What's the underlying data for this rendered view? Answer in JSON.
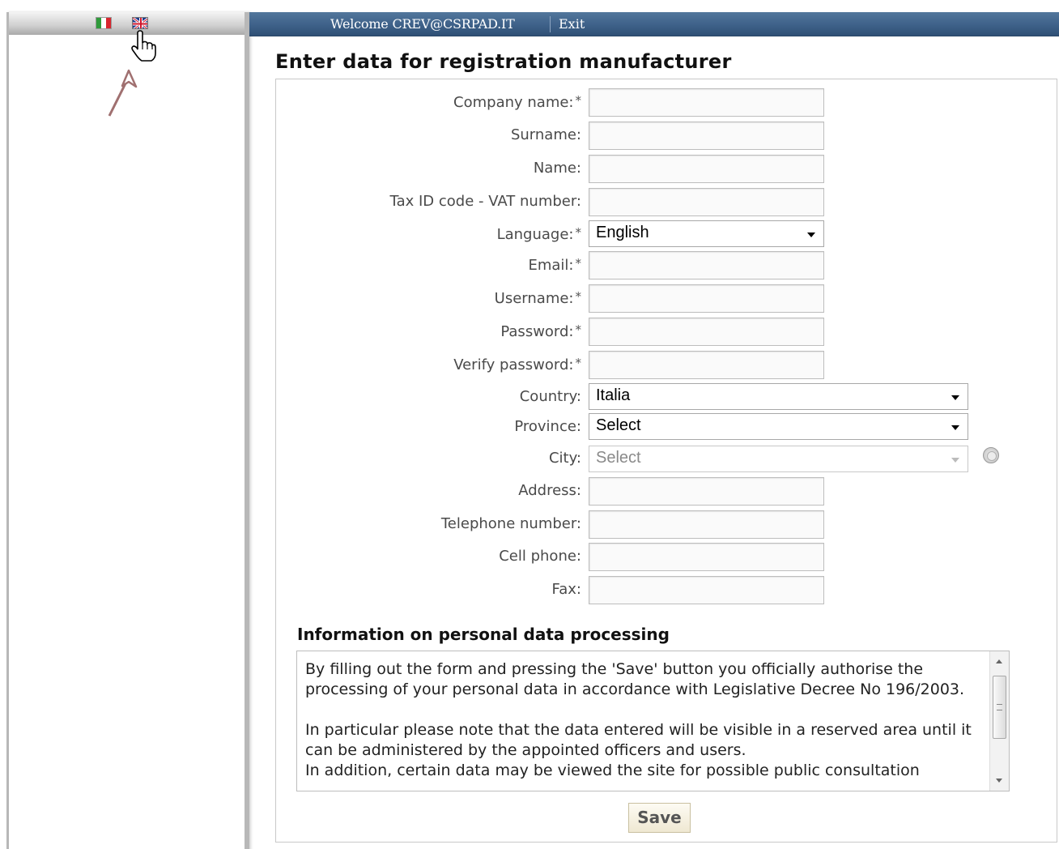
{
  "header": {
    "welcome_text": "Welcome CREV@CSRPAD.IT",
    "exit_label": "Exit"
  },
  "languages": [
    {
      "name": "Italian",
      "icon": "italian-flag-icon",
      "colors": [
        "#2f9a3a",
        "#ffffff",
        "#d7262e"
      ]
    },
    {
      "name": "English",
      "icon": "uk-flag-icon",
      "colors": [
        "#1d3a8c",
        "#ffffff",
        "#cf142b"
      ]
    }
  ],
  "page_title": "Enter data for registration manufacturer",
  "form": {
    "required_mark": "*",
    "company_name_label": "Company name:",
    "surname_label": "Surname:",
    "name_label": "Name:",
    "tax_id_label": "Tax ID code - VAT number:",
    "language_label": "Language:",
    "language_value": "English",
    "email_label": "Email:",
    "username_label": "Username:",
    "password_label": "Password:",
    "verify_password_label": "Verify password:",
    "country_label": "Country:",
    "country_value": "Italia",
    "province_label": "Province:",
    "province_value": "Select",
    "city_label": "City:",
    "city_value": "Select",
    "address_label": "Address:",
    "telephone_label": "Telephone number:",
    "cell_phone_label": "Cell phone:",
    "fax_label": "Fax:"
  },
  "privacy": {
    "title": "Information on personal data processing",
    "paragraph_1": "By filling out the form and pressing the 'Save' button you officially authorise the processing of your personal data in accordance with Legislative Decree No 196/2003.",
    "paragraph_2": "In particular please note that the data entered will be visible in a reserved area until it can be administered by the appointed officers and users.",
    "paragraph_3": "In addition, certain data may be viewed the site for possible public consultation"
  },
  "save_label": "Save",
  "colors": {
    "topbar": "#3e6189",
    "sidebar_border": "#b8b8b8",
    "annotation_arrow": "#a07070"
  }
}
